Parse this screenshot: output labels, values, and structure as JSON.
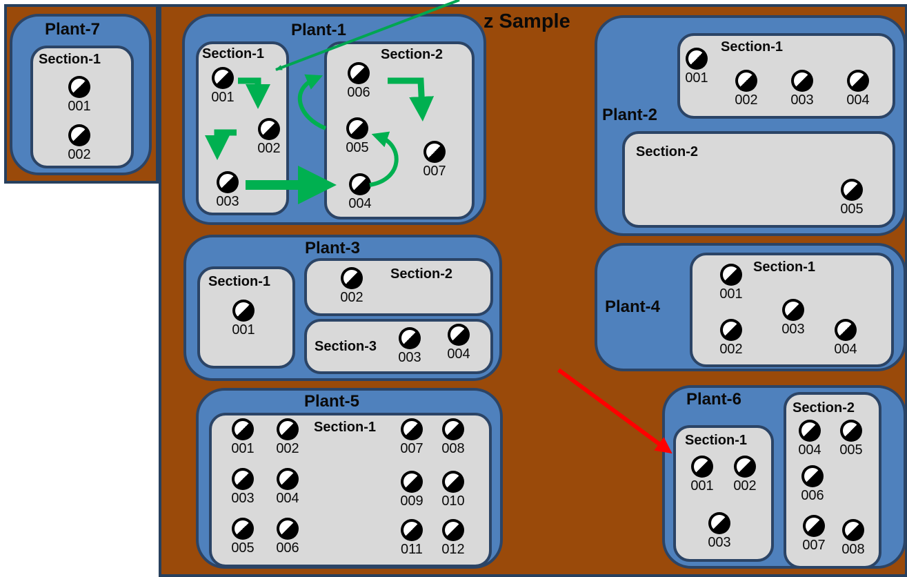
{
  "title": "z Sample",
  "colors": {
    "sample_bg": "#9a4a0a",
    "plant_bg": "#4f81bd",
    "section_bg": "#d9d9d9",
    "border": "#2b4466",
    "flow_arrow": "#00b050",
    "pointer_green": "#00a651",
    "pointer_red": "#ff0000"
  },
  "icon": "knob-icon",
  "plant7": {
    "label": "Plant-7",
    "s1": {
      "label": "Section-1",
      "devices": [
        "001",
        "002"
      ]
    }
  },
  "plant1": {
    "label": "Plant-1",
    "s1": {
      "label": "Section-1",
      "devices": [
        "001",
        "002",
        "003"
      ]
    },
    "s2": {
      "label": "Section-2",
      "devices": [
        "004",
        "005",
        "006",
        "007"
      ]
    }
  },
  "plant2": {
    "label": "Plant-2",
    "s1": {
      "label": "Section-1",
      "devices": [
        "001",
        "002",
        "003",
        "004"
      ]
    },
    "s2": {
      "label": "Section-2",
      "devices": [
        "005"
      ]
    }
  },
  "plant3": {
    "label": "Plant-3",
    "s1": {
      "label": "Section-1",
      "devices": [
        "001"
      ]
    },
    "s2": {
      "label": "Section-2",
      "devices": [
        "002"
      ]
    },
    "s3": {
      "label": "Section-3",
      "devices": [
        "003",
        "004"
      ]
    }
  },
  "plant4": {
    "label": "Plant-4",
    "s1": {
      "label": "Section-1",
      "devices": [
        "001",
        "002",
        "003",
        "004"
      ]
    }
  },
  "plant5": {
    "label": "Plant-5",
    "s1": {
      "label": "Section-1",
      "devices": [
        "001",
        "002",
        "003",
        "004",
        "005",
        "006",
        "007",
        "008",
        "009",
        "010",
        "011",
        "012"
      ]
    }
  },
  "plant6": {
    "label": "Plant-6",
    "s1": {
      "label": "Section-1",
      "devices": [
        "001",
        "002",
        "003"
      ]
    },
    "s2": {
      "label": "Section-2",
      "devices": [
        "004",
        "005",
        "006",
        "007",
        "008"
      ]
    }
  }
}
